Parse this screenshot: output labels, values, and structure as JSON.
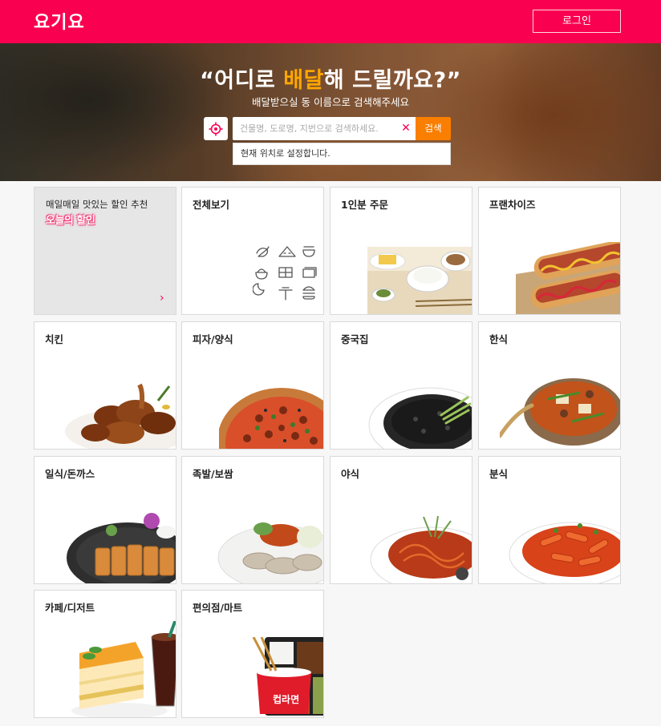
{
  "header": {
    "logo": "요기요",
    "login_label": "로그인"
  },
  "hero": {
    "title_prefix": "“어디로 ",
    "title_accent": "배달",
    "title_suffix": "해 드릴까요?”",
    "subtitle": "배달받으실 동 이름으로 검색해주세요",
    "search_placeholder": "건물명, 도로명, 지번으로 검색하세요.",
    "search_value": "",
    "search_button": "검색",
    "current_location": "현재 위치로 설정합니다."
  },
  "promo": {
    "title": "매일매일 맛있는 할인 추천",
    "badge": "오늘의 할인"
  },
  "categories": [
    {
      "label": "전체보기",
      "icon": "category-icons"
    },
    {
      "label": "1인분 주문",
      "icon": "single-meal-photo"
    },
    {
      "label": "프랜차이즈",
      "icon": "hotdog-photo"
    },
    {
      "label": "치킨",
      "icon": "chicken-photo"
    },
    {
      "label": "피자/양식",
      "icon": "pizza-photo"
    },
    {
      "label": "중국집",
      "icon": "jjajangmyeon-photo"
    },
    {
      "label": "한식",
      "icon": "stew-photo"
    },
    {
      "label": "일식/돈까스",
      "icon": "tonkatsu-photo"
    },
    {
      "label": "족발/보쌈",
      "icon": "bossam-photo"
    },
    {
      "label": "야식",
      "icon": "nightfood-photo"
    },
    {
      "label": "분식",
      "icon": "tteokbokki-photo"
    },
    {
      "label": "카페/디저트",
      "icon": "cake-drink-photo"
    },
    {
      "label": "편의점/마트",
      "icon": "convenience-photo"
    }
  ],
  "convenience_cup": "컵라면",
  "colors": {
    "brand": "#fa0050",
    "search": "#fa7e00",
    "accent": "#ffa600"
  }
}
